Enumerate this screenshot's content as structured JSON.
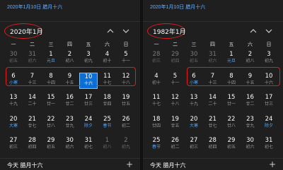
{
  "left": {
    "date_line": "2020年1月10日 腊月十六",
    "month_title": "2020年1月",
    "weekdays": [
      "一",
      "二",
      "三",
      "四",
      "五",
      "六",
      "日"
    ],
    "rows": [
      [
        {
          "n": "30",
          "l": "初五",
          "o": true
        },
        {
          "n": "31",
          "l": "初六",
          "o": true
        },
        {
          "n": "1",
          "l": "元旦",
          "f": true
        },
        {
          "n": "2",
          "l": "初八"
        },
        {
          "n": "3",
          "l": "初九"
        },
        {
          "n": "4",
          "l": "初十"
        },
        {
          "n": "5",
          "l": "十一"
        }
      ],
      [
        {
          "n": "6",
          "l": "小寒",
          "f": true
        },
        {
          "n": "7",
          "l": "十三"
        },
        {
          "n": "8",
          "l": "十四"
        },
        {
          "n": "9",
          "l": "十五"
        },
        {
          "n": "10",
          "l": "十六",
          "t": true
        },
        {
          "n": "11",
          "l": "十七"
        },
        {
          "n": "12",
          "l": "十八"
        }
      ],
      [
        {
          "n": "13",
          "l": "十九"
        },
        {
          "n": "14",
          "l": "二十"
        },
        {
          "n": "15",
          "l": "廿一"
        },
        {
          "n": "16",
          "l": "廿二"
        },
        {
          "n": "17",
          "l": "廿三"
        },
        {
          "n": "18",
          "l": "廿四"
        },
        {
          "n": "19",
          "l": "廿五"
        }
      ],
      [
        {
          "n": "20",
          "l": "大寒",
          "f": true
        },
        {
          "n": "21",
          "l": "廿七"
        },
        {
          "n": "22",
          "l": "廿八"
        },
        {
          "n": "23",
          "l": "廿九"
        },
        {
          "n": "24",
          "l": "除夕",
          "f": true
        },
        {
          "n": "25",
          "l": "春节",
          "f": true
        },
        {
          "n": "26",
          "l": "初二"
        }
      ],
      [
        {
          "n": "27",
          "l": "初三"
        },
        {
          "n": "28",
          "l": "初四"
        },
        {
          "n": "29",
          "l": "初五"
        },
        {
          "n": "30",
          "l": "初六"
        },
        {
          "n": "31",
          "l": "初七"
        },
        {
          "n": "1",
          "l": "初八",
          "o": true
        },
        {
          "n": "2",
          "l": "初九",
          "o": true
        }
      ]
    ],
    "today_text": "今天 腊月十六",
    "add_label": "+"
  },
  "right": {
    "date_line": "2020年1月10日 腊月十六",
    "month_title": "1982年1月",
    "weekdays": [
      "一",
      "二",
      "三",
      "四",
      "五",
      "六",
      "日"
    ],
    "rows": [
      [
        {
          "n": "28",
          "l": "初三",
          "o": true
        },
        {
          "n": "29",
          "l": "初四",
          "o": true
        },
        {
          "n": "30",
          "l": "初五",
          "o": true
        },
        {
          "n": "31",
          "l": "初六",
          "o": true
        },
        {
          "n": "1",
          "l": "元旦",
          "f": true
        },
        {
          "n": "2",
          "l": "初八"
        },
        {
          "n": "3",
          "l": "初九"
        }
      ],
      [
        {
          "n": "4",
          "l": "初十"
        },
        {
          "n": "5",
          "l": "十一"
        },
        {
          "n": "6",
          "l": "小寒",
          "f": true
        },
        {
          "n": "7",
          "l": "十三"
        },
        {
          "n": "8",
          "l": "十四"
        },
        {
          "n": "9",
          "l": "十五"
        },
        {
          "n": "10",
          "l": "十六"
        }
      ],
      [
        {
          "n": "11",
          "l": "十七"
        },
        {
          "n": "12",
          "l": "十八"
        },
        {
          "n": "13",
          "l": "十九"
        },
        {
          "n": "14",
          "l": "二十"
        },
        {
          "n": "15",
          "l": "廿一"
        },
        {
          "n": "16",
          "l": "廿二"
        },
        {
          "n": "17",
          "l": "廿三"
        }
      ],
      [
        {
          "n": "18",
          "l": "廿四"
        },
        {
          "n": "19",
          "l": "廿五"
        },
        {
          "n": "20",
          "l": "大寒",
          "f": true
        },
        {
          "n": "21",
          "l": "廿七"
        },
        {
          "n": "22",
          "l": "廿八"
        },
        {
          "n": "23",
          "l": "廿九"
        },
        {
          "n": "24",
          "l": "除夕",
          "f": true
        }
      ],
      [
        {
          "n": "25",
          "l": "春节",
          "f": true
        },
        {
          "n": "26",
          "l": "初二"
        },
        {
          "n": "27",
          "l": "初三"
        },
        {
          "n": "28",
          "l": "初四"
        },
        {
          "n": "29",
          "l": "初五"
        },
        {
          "n": "30",
          "l": "初六"
        },
        {
          "n": "31",
          "l": "初七"
        }
      ]
    ],
    "today_text": "今天 腊月十六",
    "add_label": "+"
  },
  "colors": {
    "accent": "#0b6fd6",
    "annotation_red": "#e21b1b",
    "festival_blue": "#4aa3ff"
  }
}
